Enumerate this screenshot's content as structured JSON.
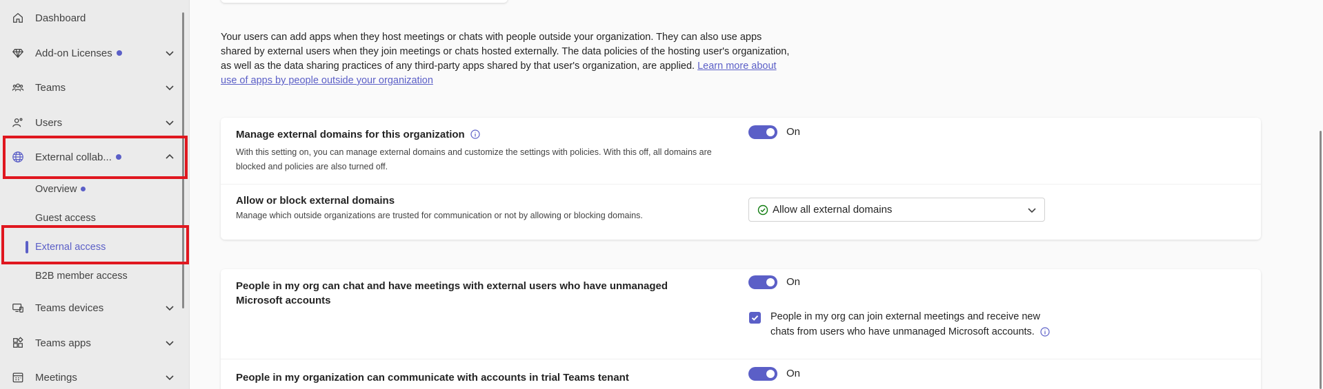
{
  "sidebar": {
    "items": [
      {
        "label": "Dashboard"
      },
      {
        "label": "Add-on Licenses"
      },
      {
        "label": "Teams"
      },
      {
        "label": "Users"
      },
      {
        "label": "External collab..."
      },
      {
        "label": "Teams devices"
      },
      {
        "label": "Teams apps"
      },
      {
        "label": "Meetings"
      }
    ],
    "subitems": [
      {
        "label": "Overview"
      },
      {
        "label": "Guest access"
      },
      {
        "label": "External access"
      },
      {
        "label": "B2B member access"
      }
    ]
  },
  "intro": {
    "text": "Your users can add apps when they host meetings or chats with people outside your organization. They can also use apps shared by external users when they join meetings or chats hosted externally. The data policies of the hosting user's organization, as well as the data sharing practices of any third-party apps shared by that user's organization, are applied. ",
    "link": "Learn more about use of apps by people outside your organization"
  },
  "card1": {
    "row1_title": "Manage external domains for this organization",
    "row1_desc": "With this setting on, you can manage external domains and customize the settings with policies. With this off, all domains are blocked and policies are also turned off.",
    "row1_toggle": "On",
    "row2_title": "Allow or block external domains",
    "row2_desc": "Manage which outside organizations are trusted for communication or not by allowing or blocking domains.",
    "row2_select": "Allow all external domains"
  },
  "card2": {
    "row1_title": "People in my org can chat and have meetings with external users who have unmanaged Microsoft accounts",
    "row1_toggle": "On",
    "row1_check": "People in my org can join external meetings and receive new chats from users who have unmanaged Microsoft accounts.",
    "row2_title": "People in my organization can communicate with accounts in trial Teams tenant",
    "row2_toggle": "On"
  },
  "colors": {
    "accent": "#5b5fc7",
    "highlight": "#e0171f"
  }
}
